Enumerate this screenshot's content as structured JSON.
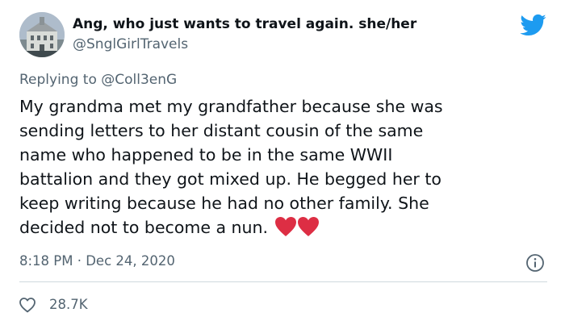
{
  "author": {
    "display_name": "Ang, who just wants to travel again. she/her",
    "handle": "@SnglGirlTravels",
    "avatar_icon": "building-photo-avatar"
  },
  "reply": {
    "prefix": "Replying to ",
    "mention": "@Coll3enG"
  },
  "tweet": {
    "lines": [
      "My grandma met my grandfather because she was",
      "sending letters to her distant cousin of the same",
      "name who happened to be in the same WWII",
      "battalion and they got mixed up. He begged her to",
      "keep writing because he had no other family. She",
      "decided not to become a nun."
    ],
    "emoji": "two-red-hearts"
  },
  "meta": {
    "timestamp": "8:18 PM · Dec 24, 2020"
  },
  "stats": {
    "likes": "28.7K"
  },
  "colors": {
    "brand": "#1d9bf0",
    "heart": "#dd2e44",
    "secondary_text": "#536471",
    "divider": "#cfd9de"
  },
  "icons": [
    "twitter-bird-icon",
    "info-icon",
    "heart-outline-icon"
  ]
}
